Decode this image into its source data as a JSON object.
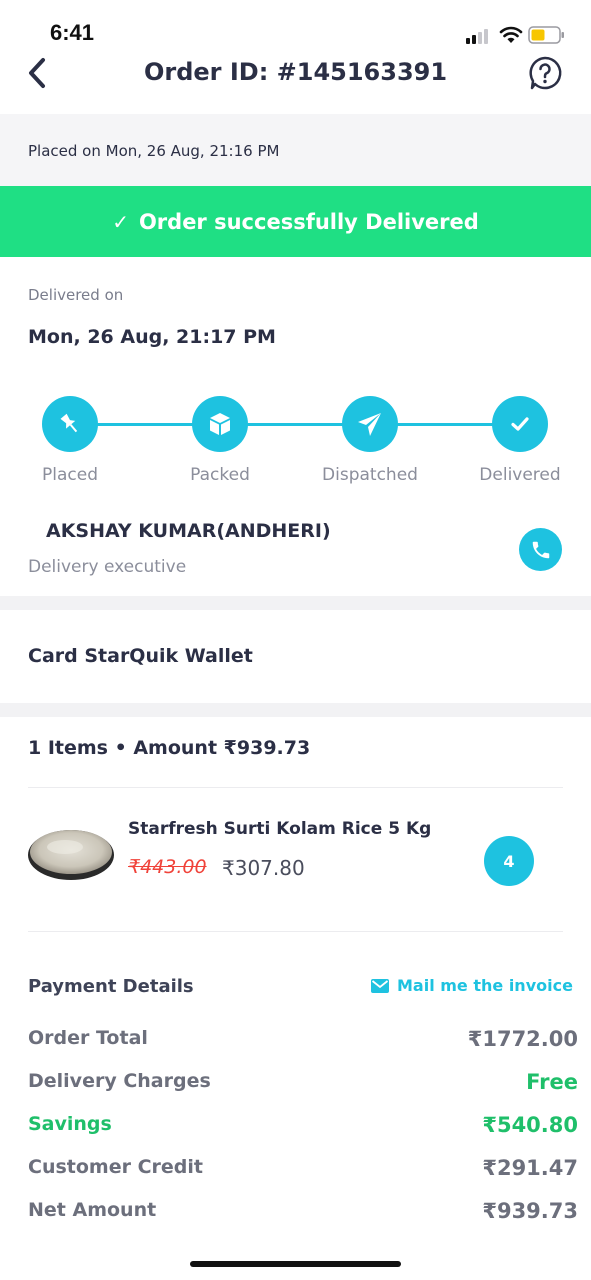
{
  "status_bar": {
    "time": "6:41"
  },
  "header": {
    "title": "Order ID: #145163391"
  },
  "order": {
    "placed_text": "Placed on Mon, 26 Aug, 21:16 PM",
    "status_banner": "Order successfully Delivered",
    "delivered_on_label": "Delivered on",
    "delivered_on_date": "Mon, 26 Aug, 21:17 PM"
  },
  "progress": {
    "steps": [
      {
        "label": "Placed",
        "icon": "pin-icon"
      },
      {
        "label": "Packed",
        "icon": "box-icon"
      },
      {
        "label": "Dispatched",
        "icon": "paper-plane-icon"
      },
      {
        "label": "Delivered",
        "icon": "check-icon"
      }
    ]
  },
  "executive": {
    "name": "AKSHAY KUMAR(ANDHERI)",
    "role": "Delivery executive"
  },
  "payment_method": "Card StarQuik Wallet",
  "items": {
    "summary": "1 Items • Amount ₹939.73",
    "list": [
      {
        "name": "Starfresh Surti Kolam Rice 5 Kg",
        "old_price": "₹443.00",
        "price": "₹307.80",
        "qty": "4"
      }
    ]
  },
  "payment_details": {
    "title": "Payment Details",
    "mail_label": "Mail me the invoice",
    "rows": [
      {
        "label": "Order Total",
        "value": "₹1772.00"
      },
      {
        "label": "Delivery Charges",
        "value": "Free"
      },
      {
        "label": "Savings",
        "value": "₹540.80"
      },
      {
        "label": "Customer Credit",
        "value": "₹291.47"
      },
      {
        "label": "Net Amount",
        "value": "₹939.73"
      }
    ]
  },
  "colors": {
    "accent": "#1ec2e0",
    "success": "#1fdf84",
    "savings": "#1fbf6a",
    "strike": "#f0433a"
  }
}
